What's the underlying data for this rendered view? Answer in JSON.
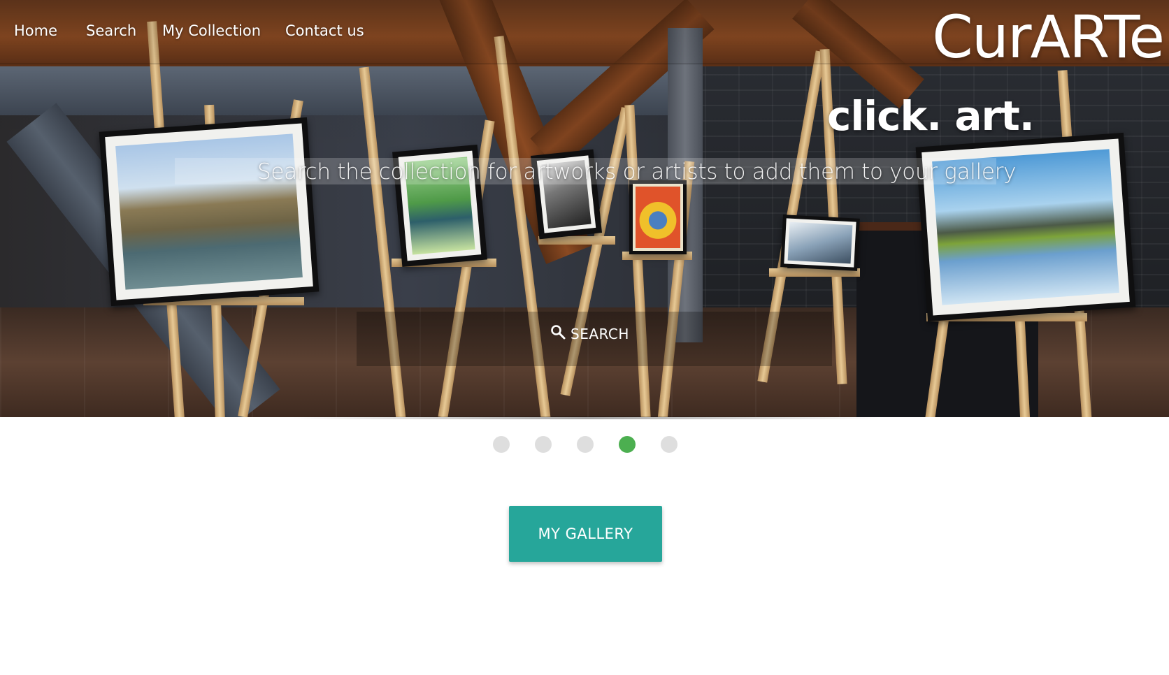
{
  "nav": {
    "items": [
      {
        "label": "Home"
      },
      {
        "label": "Search"
      },
      {
        "label": "My Collection"
      },
      {
        "label": "Contact us"
      }
    ],
    "brand": "CurARTe"
  },
  "hero": {
    "title": "click. art.",
    "subtitle": "Search the collection for artworks or artists to add them to your gallery",
    "search_label": "SEARCH",
    "search_icon": "search-icon"
  },
  "carousel": {
    "slide_count": 5,
    "active_index": 3,
    "active_color": "#4caf50",
    "inactive_color": "#dedede"
  },
  "cta": {
    "gallery_label": "MY GALLERY",
    "color": "#26a69a"
  }
}
